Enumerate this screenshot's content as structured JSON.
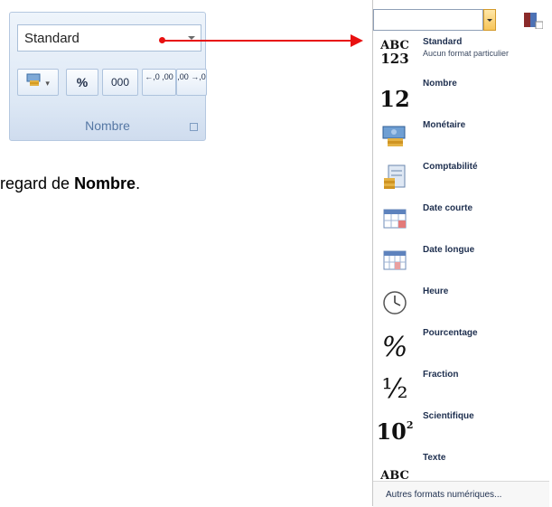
{
  "ribbon": {
    "format_value": "Standard",
    "percent_label": "%",
    "thousands_label": "000",
    "increase_decimal_label": "←,0 ,00",
    "decrease_decimal_label": ",00 →,0",
    "group_label": "Nombre"
  },
  "caption": {
    "prefix": "regard de ",
    "bold": "Nombre",
    "suffix": "."
  },
  "dropdown": {
    "items": [
      {
        "label": "Standard",
        "sub": "Aucun format particulier",
        "icon": "abc-123-icon",
        "glyph_top": "ABC",
        "glyph_bottom": "123"
      },
      {
        "label": "Nombre",
        "icon": "number-12-icon",
        "glyph": "12"
      },
      {
        "label": "Monétaire",
        "icon": "currency-icon"
      },
      {
        "label": "Comptabilité",
        "icon": "accounting-icon"
      },
      {
        "label": "Date courte",
        "icon": "short-date-icon"
      },
      {
        "label": "Date longue",
        "icon": "long-date-icon"
      },
      {
        "label": "Heure",
        "icon": "clock-icon"
      },
      {
        "label": "Pourcentage",
        "icon": "percent-icon",
        "glyph": "%"
      },
      {
        "label": "Fraction",
        "icon": "fraction-icon",
        "glyph": "½"
      },
      {
        "label": "Scientifique",
        "icon": "scientific-icon",
        "glyph": "10",
        "glyph_sup": "2"
      },
      {
        "label": "Texte",
        "icon": "text-abc-icon",
        "glyph": "ABC"
      }
    ],
    "footer": "Autres formats numériques..."
  },
  "colors": {
    "arrow": "#e81010",
    "ribbon_bg": "#dde8f5",
    "group_label": "#5577a4"
  }
}
